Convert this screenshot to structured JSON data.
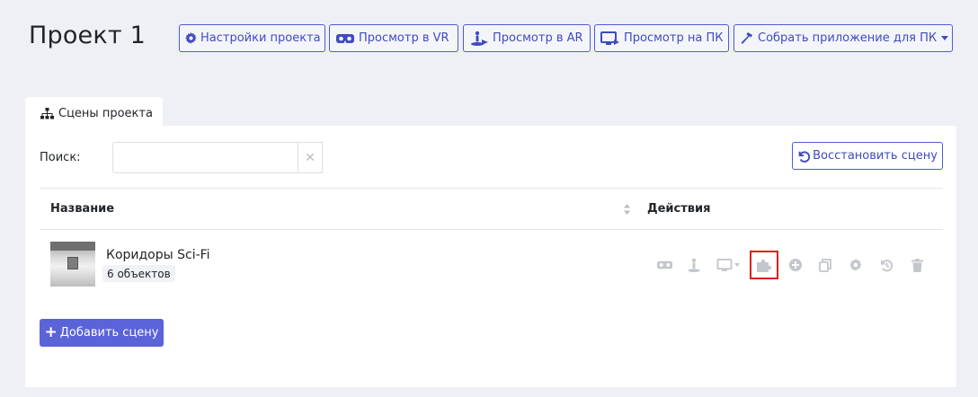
{
  "project": {
    "title": "Проект 1"
  },
  "toolbar": {
    "settings_label": "Настройки проекта",
    "vr_label": "Просмотр в VR",
    "ar_label": "Просмотр в AR",
    "pc_label": "Просмотр на ПК",
    "build_label": "Собрать приложение для ПК"
  },
  "tabs": {
    "scenes_label": "Сцены проекта"
  },
  "search": {
    "label": "Поиск:",
    "value": "",
    "placeholder": ""
  },
  "restore_label": "Восстановить сцену",
  "table": {
    "col_name": "Название",
    "col_actions": "Действия",
    "rows": [
      {
        "name": "Коридоры Sci-Fi",
        "badge": "6 объектов"
      }
    ]
  },
  "add_scene_label": "Добавить сцену",
  "colors": {
    "accent": "#4e5bd4",
    "primary_button": "#5a63d8",
    "highlight": "#e01b1b",
    "icon_muted": "#c3c6cc"
  },
  "icons": [
    "gear-icon",
    "vr-headset-icon",
    "ar-person-icon",
    "monitor-icon",
    "hammer-icon",
    "sitemap-icon",
    "undo-icon",
    "sort-icon",
    "puzzle-icon",
    "plus-circle-icon",
    "copy-icon",
    "history-icon",
    "trash-icon"
  ]
}
